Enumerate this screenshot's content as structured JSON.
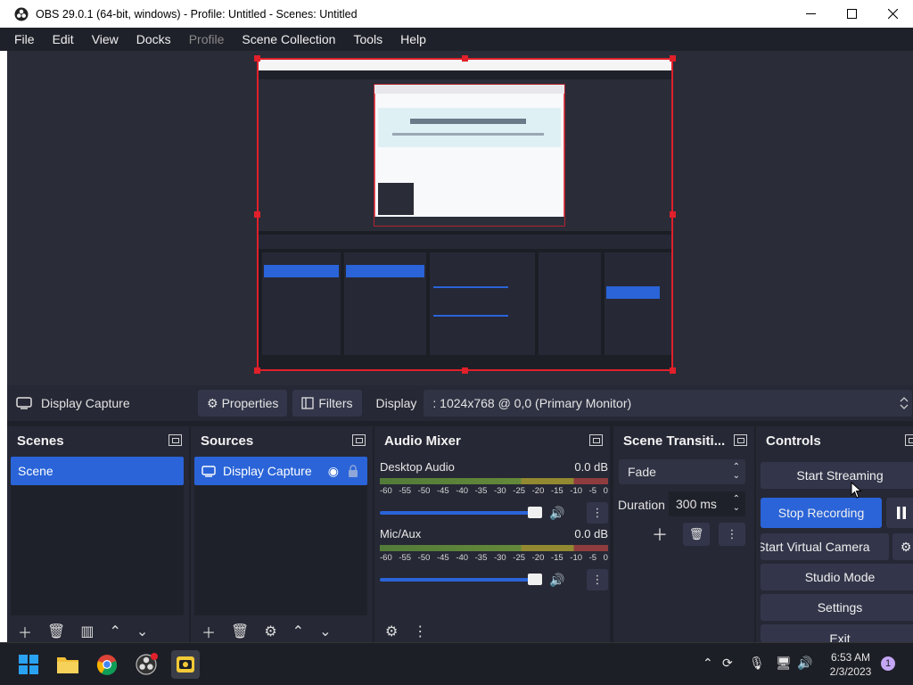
{
  "window": {
    "title": "OBS 29.0.1 (64-bit, windows) - Profile: Untitled - Scenes: Untitled",
    "minimize_glyph": "—",
    "maximize_glyph": "☐",
    "close_glyph": "✕"
  },
  "menu": {
    "items": [
      {
        "label": "File",
        "disabled": false
      },
      {
        "label": "Edit",
        "disabled": false
      },
      {
        "label": "View",
        "disabled": false
      },
      {
        "label": "Docks",
        "disabled": false
      },
      {
        "label": "Profile",
        "disabled": true
      },
      {
        "label": "Scene Collection",
        "disabled": false
      },
      {
        "label": "Tools",
        "disabled": false
      },
      {
        "label": "Help",
        "disabled": false
      }
    ]
  },
  "source_toolbar": {
    "source_name": "Display Capture",
    "properties_label": "Properties",
    "filters_label": "Filters",
    "display_label": "Display",
    "display_value": ": 1024x768 @ 0,0 (Primary Monitor)"
  },
  "docks": {
    "scenes": {
      "title": "Scenes",
      "items": [
        "Scene"
      ]
    },
    "sources": {
      "title": "Sources",
      "items": [
        "Display Capture"
      ]
    },
    "audio_mixer": {
      "title": "Audio Mixer",
      "ticks": [
        "-60",
        "-55",
        "-50",
        "-45",
        "-40",
        "-35",
        "-30",
        "-25",
        "-20",
        "-15",
        "-10",
        "-5",
        "0"
      ],
      "channels": [
        {
          "name": "Desktop Audio",
          "level": "0.0 dB",
          "volume": 1.0
        },
        {
          "name": "Mic/Aux",
          "level": "0.0 dB",
          "volume": 1.0
        }
      ]
    },
    "transitions": {
      "title": "Scene Transiti...",
      "transition": "Fade",
      "duration_label": "Duration",
      "duration_value": "300 ms"
    },
    "controls": {
      "title": "Controls",
      "start_streaming": "Start Streaming",
      "stop_recording": "Stop Recording",
      "start_virtual_camera": "Start Virtual Camera",
      "studio_mode": "Studio Mode",
      "settings": "Settings",
      "exit": "Exit"
    }
  },
  "taskbar": {
    "clock_time": "6:53 AM",
    "clock_date": "2/3/2023",
    "notification_count": "1"
  },
  "colors": {
    "accent": "#2a64d8",
    "selection_border": "#e0202a",
    "panel": "#262835",
    "background": "#1f212a"
  }
}
